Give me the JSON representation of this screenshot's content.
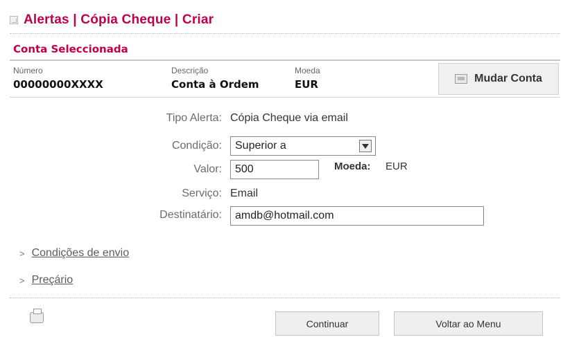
{
  "header": {
    "title": "Alertas | Cópia Cheque | Criar"
  },
  "account": {
    "section_title": "Conta Seleccionada",
    "labels": {
      "numero": "Número",
      "descricao": "Descrição",
      "moeda": "Moeda"
    },
    "values": {
      "numero": "00000000XXXX",
      "descricao": "Conta à Ordem",
      "moeda": "EUR"
    },
    "change_button_label": "Mudar Conta"
  },
  "form": {
    "tipo_alerta_label": "Tipo Alerta:",
    "tipo_alerta_value": "Cópia Cheque via email",
    "condicao_label": "Condição:",
    "condicao_value": "Superior a",
    "valor_label": "Valor:",
    "valor_value": "500",
    "moeda_label": "Moeda:",
    "moeda_value": "EUR",
    "servico_label": "Serviço:",
    "servico_value": "Email",
    "destinatario_label": "Destinatário:",
    "destinatario_value": "amdb@hotmail.com"
  },
  "links": {
    "condicoes_envio": "Condições de envio",
    "precario": "Preçário"
  },
  "footer": {
    "continue_label": "Continuar",
    "back_label": "Voltar ao Menu"
  },
  "icons": {
    "title_icon": "window-icon",
    "change_account_icon": "account-card-icon",
    "printer_icon": "printer-icon",
    "select_arrow": "chevron-down-icon"
  }
}
